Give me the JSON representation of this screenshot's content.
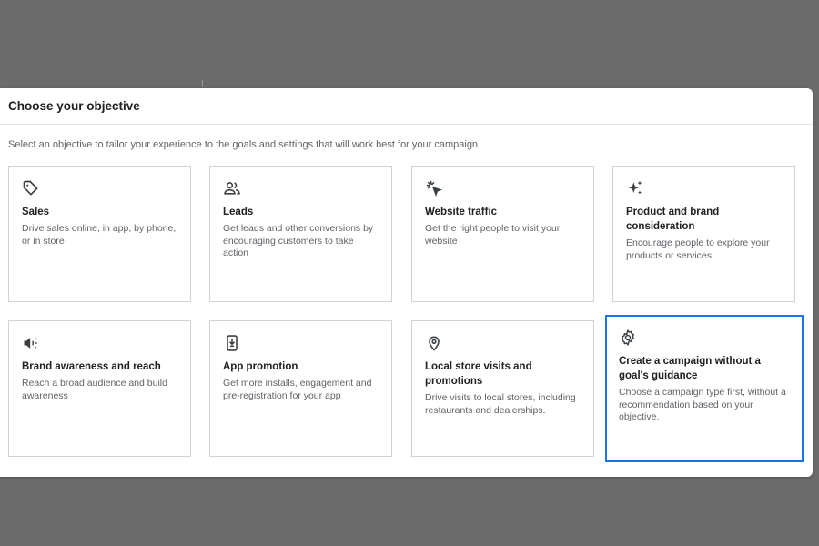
{
  "dialog": {
    "title": "Choose your objective",
    "subtitle": "Select an objective to tailor your experience to the goals and settings that will work best for your campaign"
  },
  "objectives": [
    {
      "icon": "tag-icon",
      "title": "Sales",
      "description": "Drive sales online, in app, by phone, or in store",
      "selected": false
    },
    {
      "icon": "people-icon",
      "title": "Leads",
      "description": "Get leads and other conversions by encouraging customers to take action",
      "selected": false
    },
    {
      "icon": "cursor-click-icon",
      "title": "Website traffic",
      "description": "Get the right people to visit your website",
      "selected": false
    },
    {
      "icon": "sparkle-icon",
      "title": "Product and brand consideration",
      "description": "Encourage people to explore your products or services",
      "selected": false
    },
    {
      "icon": "megaphone-icon",
      "title": "Brand awareness and reach",
      "description": "Reach a broad audience and build awareness",
      "selected": false
    },
    {
      "icon": "phone-download-icon",
      "title": "App promotion",
      "description": "Get more installs, engagement and pre-registration for your app",
      "selected": false
    },
    {
      "icon": "location-pin-icon",
      "title": "Local store visits and promotions",
      "description": "Drive visits to local stores, including restaurants and dealerships.",
      "selected": false
    },
    {
      "icon": "gear-icon",
      "title": "Create a campaign without a goal's guidance",
      "description": "Choose a campaign type first, without a recommendation based on your objective.",
      "selected": true
    }
  ],
  "colors": {
    "accent": "#1a73e8",
    "backdrop": "#6b6b6b"
  }
}
